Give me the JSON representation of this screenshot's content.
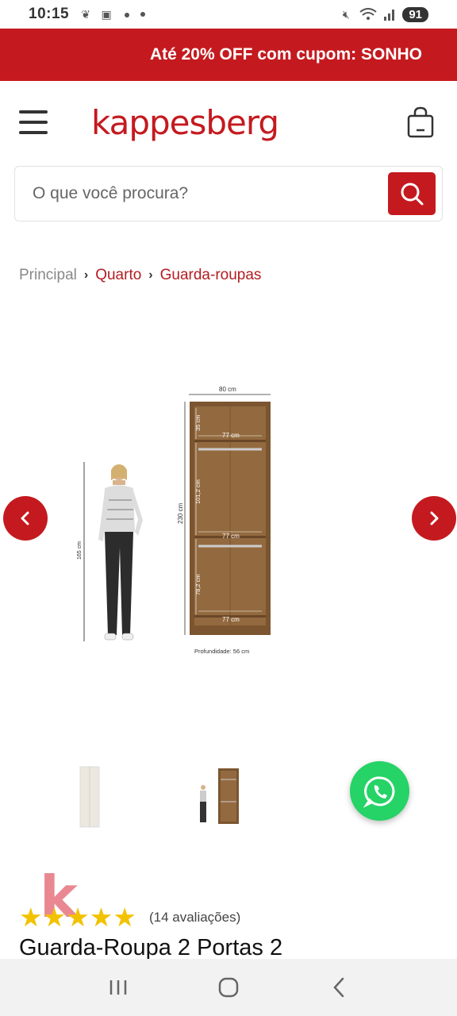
{
  "status_bar": {
    "time": "10:15",
    "battery": "91"
  },
  "promo": {
    "text": "Até 20% OFF com cupom: SONHO"
  },
  "header": {
    "logo": "kappesberg"
  },
  "search": {
    "placeholder": "O que você procura?"
  },
  "breadcrumb": [
    "Principal",
    "Quarto",
    "Guarda-roupas"
  ],
  "product_image": {
    "dimensions": {
      "width": "80 cm",
      "height": "230 cm",
      "inner_width": "77 cm",
      "section_top": "35 cm",
      "section_middle": "101,2 cm",
      "section_bottom": "78,2 cm",
      "person_height": "165 cm",
      "depth": "Profundidade: 56 cm"
    }
  },
  "rating": {
    "stars": 5,
    "text": "(14 avaliações)"
  },
  "product": {
    "title": "Guarda-Roupa 2 Portas 2"
  },
  "colors": {
    "brand_red": "#c41a1f",
    "whatsapp_green": "#25d366",
    "star_yellow": "#f2c200"
  }
}
